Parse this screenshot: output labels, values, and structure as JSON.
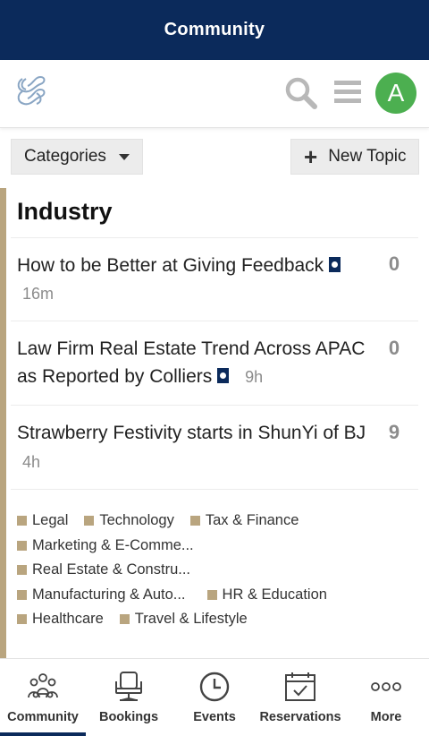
{
  "titlebar": {
    "title": "Community"
  },
  "header": {
    "avatar_letter": "A"
  },
  "toolbar": {
    "categories_label": "Categories",
    "new_topic_label": "New Topic"
  },
  "section": {
    "title": "Industry"
  },
  "topics": [
    {
      "title": "How to be Better at Giving Feedback",
      "pinned": true,
      "age": "16m",
      "count": "0"
    },
    {
      "title_line1": "Law Firm Real Estate Trend Across APAC",
      "title_line2": "as Reported by Colliers",
      "pinned": true,
      "age": "9h",
      "count": "0"
    },
    {
      "title": "Strawberry Festivity starts in ShunYi of BJ",
      "pinned": false,
      "age": "4h",
      "count": "9"
    }
  ],
  "tags": [
    [
      "Legal",
      "Technology",
      "Tax & Finance"
    ],
    [
      "Marketing & E-Comme..."
    ],
    [
      "Real Estate & Constru..."
    ],
    [
      "Manufacturing & Auto...",
      "HR & Education"
    ],
    [
      "Healthcare",
      "Travel & Lifestyle"
    ]
  ],
  "bottom_nav": [
    {
      "label": "Community",
      "icon": "community-icon",
      "active": true
    },
    {
      "label": "Bookings",
      "icon": "chair-icon",
      "active": false
    },
    {
      "label": "Events",
      "icon": "clock-icon",
      "active": false
    },
    {
      "label": "Reservations",
      "icon": "calendar-check-icon",
      "active": false
    },
    {
      "label": "More",
      "icon": "more-dots-icon",
      "active": false
    }
  ],
  "colors": {
    "primary": "#0b2a5b",
    "accent": "#b9a57f",
    "avatar": "#4caf50"
  }
}
